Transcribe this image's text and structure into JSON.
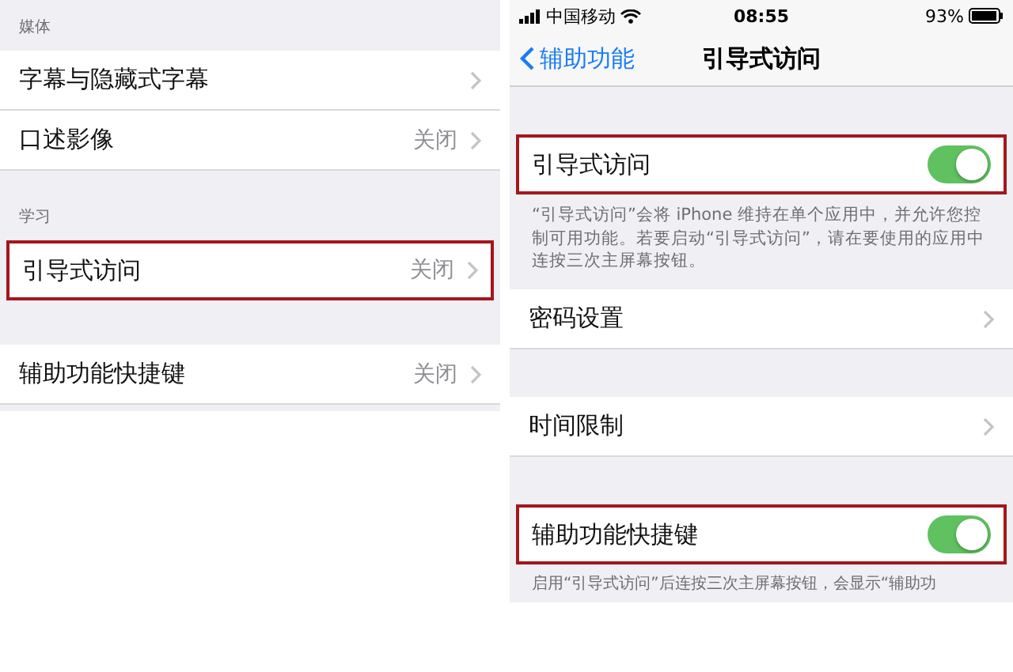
{
  "left_screen": {
    "items": [
      {
        "kind": "header",
        "label": "媒体"
      },
      {
        "kind": "row",
        "label": "字幕与隐藏式字幕",
        "highlighted": false
      },
      {
        "kind": "row",
        "label": "口述影像",
        "value": "关闭",
        "highlighted": false
      },
      {
        "kind": "header",
        "label": "学习"
      },
      {
        "kind": "row",
        "label": "引导式访问",
        "value": "关闭",
        "highlighted": true
      },
      {
        "kind": "gap"
      },
      {
        "kind": "row",
        "label": "辅助功能快捷键",
        "value": "关闭",
        "highlighted": false
      }
    ]
  },
  "right_screen": {
    "status_bar": {
      "carrier": "中国移动",
      "time": "08:55",
      "battery": "93%"
    },
    "nav_bar": {
      "back": "辅助功能",
      "title": "引导式访问"
    },
    "items": [
      {
        "kind": "gap"
      },
      {
        "kind": "toggle",
        "label": "引导式访问",
        "on": true,
        "highlighted": true
      },
      {
        "kind": "footer",
        "text": "“引导式访问”会将 iPhone 维持在单个应用中，并允许您控制可用功能。若要启动“引导式访问”，请在要使用的应用中连按三次主屏幕按钮。"
      },
      {
        "kind": "row",
        "label": "密码设置",
        "highlighted": false
      },
      {
        "kind": "gap"
      },
      {
        "kind": "row",
        "label": "时间限制",
        "highlighted": false
      },
      {
        "kind": "gap"
      },
      {
        "kind": "toggle",
        "label": "辅助功能快捷键",
        "on": true,
        "highlighted": true
      },
      {
        "kind": "footer",
        "text": "启用“引导式访问”后连按三次主屏幕按钮，会显示“辅助功"
      }
    ]
  }
}
